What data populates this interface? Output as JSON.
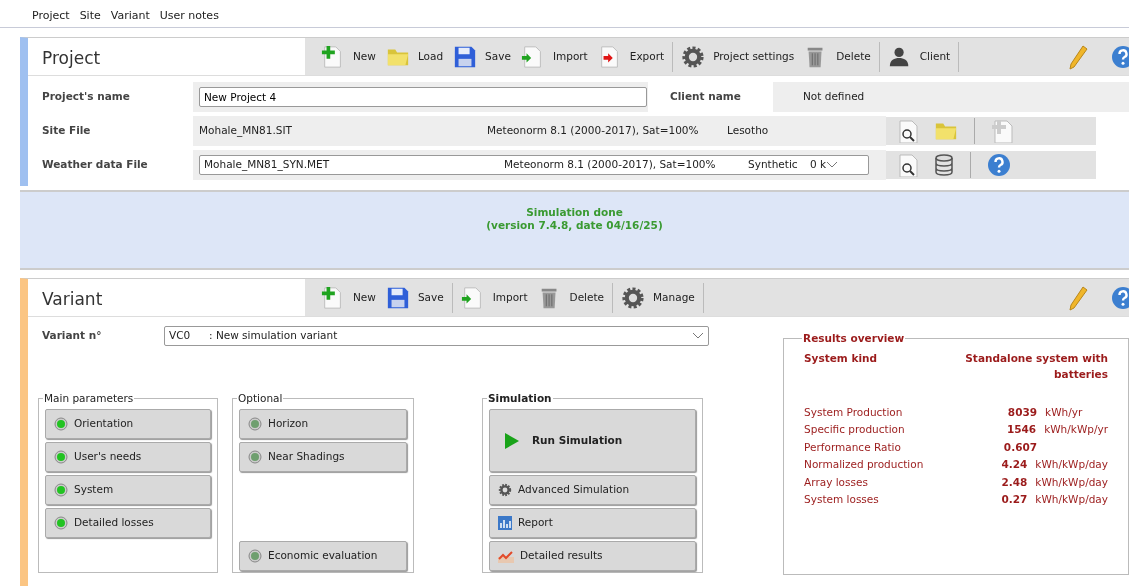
{
  "menu": [
    "Project",
    "Site",
    "Variant",
    "User notes"
  ],
  "project": {
    "title": "Project",
    "toolbar": [
      [
        {
          "kind": "new",
          "label": "New"
        },
        {
          "kind": "load",
          "label": "Load"
        },
        {
          "kind": "save",
          "label": "Save"
        },
        {
          "kind": "import",
          "label": "Import"
        },
        {
          "kind": "export",
          "label": "Export"
        }
      ],
      [
        {
          "kind": "settings",
          "label": "Project settings"
        },
        {
          "kind": "delete",
          "label": "Delete"
        }
      ],
      [
        {
          "kind": "client",
          "label": "Client"
        }
      ]
    ],
    "name_label": "Project's name",
    "name_value": "New Project 4",
    "client_label": "Client name",
    "client_value": "Not defined",
    "site": {
      "label": "Site File",
      "file": "Mohale_MN81.SIT",
      "source": "Meteonorm 8.1 (2000-2017), Sat=100%",
      "country": "Lesotho"
    },
    "weather": {
      "label": "Weather data File",
      "file": "Mohale_MN81_SYN.MET",
      "source": "Meteonorm 8.1 (2000-2017), Sat=100%",
      "type": "Synthetic",
      "extra": "0 k"
    }
  },
  "status": {
    "lines": [
      "Simulation done",
      "(version 7.4.8, date 04/16/25)"
    ]
  },
  "variant": {
    "title": "Variant",
    "toolbar": [
      [
        {
          "kind": "new",
          "label": "New"
        },
        {
          "kind": "save",
          "label": "Save"
        }
      ],
      [
        {
          "kind": "import",
          "label": "Import"
        },
        {
          "kind": "delete",
          "label": "Delete"
        }
      ],
      [
        {
          "kind": "settings",
          "label": "Manage"
        }
      ]
    ],
    "label": "Variant n°",
    "id": "VC0",
    "description": ": New simulation variant",
    "main_parameters": {
      "title": "Main parameters",
      "buttons": [
        {
          "label": "Orientation",
          "on": true
        },
        {
          "label": "User's needs",
          "on": true
        },
        {
          "label": "System",
          "on": true
        },
        {
          "label": "Detailed losses",
          "on": true
        }
      ]
    },
    "optional": {
      "title": "Optional",
      "buttons": [
        {
          "label": "Horizon",
          "on": false
        },
        {
          "label": "Near Shadings",
          "on": false
        },
        {
          "label": "Economic evaluation",
          "on": false
        }
      ]
    },
    "simulation": {
      "title": "Simulation",
      "buttons": [
        {
          "kind": "run",
          "label": "Run Simulation"
        },
        {
          "kind": "advanced",
          "label": "Advanced Simulation"
        },
        {
          "kind": "report",
          "label": "Report"
        },
        {
          "kind": "results",
          "label": "Detailed results"
        }
      ]
    },
    "results": {
      "title": "Results overview",
      "kind_label": "System kind",
      "kind_value": "Standalone system with batteries",
      "rows": [
        {
          "label": "System Production",
          "value": "8039",
          "unit": "kWh/yr"
        },
        {
          "label": "Specific production",
          "value": "1546",
          "unit": "kWh/kWp/yr"
        },
        {
          "label": "Performance Ratio",
          "value": "0.607"
        },
        {
          "label": "Normalized production",
          "value": "4.24",
          "unit": "kWh/kWp/day"
        },
        {
          "label": "Array losses",
          "value": "2.48",
          "unit": "kWh/kWp/day"
        },
        {
          "label": "System losses",
          "value": "0.27",
          "unit": "kWh/kWp/day"
        }
      ]
    }
  }
}
